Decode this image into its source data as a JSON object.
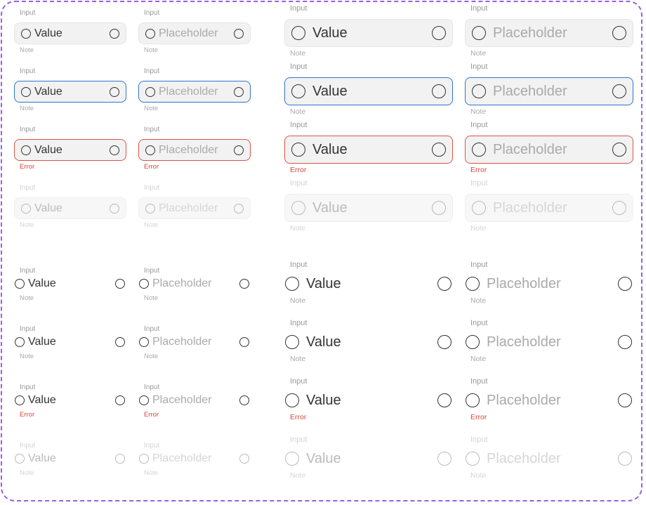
{
  "colors": {
    "focus": "#2f74d0",
    "error": "#d9453b",
    "frame": "#9b5de5"
  },
  "icons": {
    "leading": "circle-icon",
    "trailing": "circle-icon"
  },
  "fields": [
    {
      "variant": "filled",
      "size": "small",
      "state": "default",
      "label": "Input",
      "text": "Value",
      "placeholder": false,
      "note": "Note"
    },
    {
      "variant": "filled",
      "size": "small",
      "state": "default",
      "label": "Input",
      "text": "Placeholder",
      "placeholder": true,
      "note": "Note"
    },
    {
      "variant": "filled",
      "size": "large",
      "state": "default",
      "label": "Input",
      "text": "Value",
      "placeholder": false,
      "note": "Note"
    },
    {
      "variant": "filled",
      "size": "large",
      "state": "default",
      "label": "Input",
      "text": "Placeholder",
      "placeholder": true,
      "note": "Note"
    },
    {
      "variant": "filled",
      "size": "small",
      "state": "focus",
      "label": "Input",
      "text": "Value",
      "placeholder": false,
      "note": "Note"
    },
    {
      "variant": "filled",
      "size": "small",
      "state": "focus",
      "label": "Input",
      "text": "Placeholder",
      "placeholder": true,
      "note": "Note"
    },
    {
      "variant": "filled",
      "size": "large",
      "state": "focus",
      "label": "Input",
      "text": "Value",
      "placeholder": false,
      "note": "Note"
    },
    {
      "variant": "filled",
      "size": "large",
      "state": "focus",
      "label": "Input",
      "text": "Placeholder",
      "placeholder": true,
      "note": "Note"
    },
    {
      "variant": "filled",
      "size": "small",
      "state": "error",
      "label": "Input",
      "text": "Value",
      "placeholder": false,
      "note": "Error"
    },
    {
      "variant": "filled",
      "size": "small",
      "state": "error",
      "label": "Input",
      "text": "Placeholder",
      "placeholder": true,
      "note": "Error"
    },
    {
      "variant": "filled",
      "size": "large",
      "state": "error",
      "label": "Input",
      "text": "Value",
      "placeholder": false,
      "note": "Error"
    },
    {
      "variant": "filled",
      "size": "large",
      "state": "error",
      "label": "Input",
      "text": "Placeholder",
      "placeholder": true,
      "note": "Error"
    },
    {
      "variant": "filled",
      "size": "small",
      "state": "disabled",
      "label": "Input",
      "text": "Value",
      "placeholder": false,
      "note": "Note"
    },
    {
      "variant": "filled",
      "size": "small",
      "state": "disabled",
      "label": "Input",
      "text": "Placeholder",
      "placeholder": true,
      "note": "Note"
    },
    {
      "variant": "filled",
      "size": "large",
      "state": "disabled",
      "label": "Input",
      "text": "Value",
      "placeholder": false,
      "note": "Note"
    },
    {
      "variant": "filled",
      "size": "large",
      "state": "disabled",
      "label": "Input",
      "text": "Placeholder",
      "placeholder": true,
      "note": "Note"
    },
    {
      "variant": "underline",
      "size": "small",
      "state": "default",
      "label": "Input",
      "text": "Value",
      "placeholder": false,
      "note": "Note"
    },
    {
      "variant": "underline",
      "size": "small",
      "state": "default",
      "label": "Input",
      "text": "Placeholder",
      "placeholder": true,
      "note": "Note"
    },
    {
      "variant": "underline",
      "size": "large",
      "state": "default",
      "label": "Input",
      "text": "Value",
      "placeholder": false,
      "note": "Note"
    },
    {
      "variant": "underline",
      "size": "large",
      "state": "default",
      "label": "Input",
      "text": "Placeholder",
      "placeholder": true,
      "note": "Note"
    },
    {
      "variant": "underline",
      "size": "small",
      "state": "focus",
      "label": "Input",
      "text": "Value",
      "placeholder": false,
      "note": "Note"
    },
    {
      "variant": "underline",
      "size": "small",
      "state": "focus",
      "label": "Input",
      "text": "Placeholder",
      "placeholder": true,
      "note": "Note"
    },
    {
      "variant": "underline",
      "size": "large",
      "state": "focus",
      "label": "Input",
      "text": "Value",
      "placeholder": false,
      "note": "Note"
    },
    {
      "variant": "underline",
      "size": "large",
      "state": "focus",
      "label": "Input",
      "text": "Placeholder",
      "placeholder": true,
      "note": "Note"
    },
    {
      "variant": "underline",
      "size": "small",
      "state": "error",
      "label": "Input",
      "text": "Value",
      "placeholder": false,
      "note": "Error"
    },
    {
      "variant": "underline",
      "size": "small",
      "state": "error",
      "label": "Input",
      "text": "Placeholder",
      "placeholder": true,
      "note": "Error"
    },
    {
      "variant": "underline",
      "size": "large",
      "state": "error",
      "label": "Input",
      "text": "Value",
      "placeholder": false,
      "note": "Error"
    },
    {
      "variant": "underline",
      "size": "large",
      "state": "error",
      "label": "Input",
      "text": "Placeholder",
      "placeholder": true,
      "note": "Error"
    },
    {
      "variant": "underline",
      "size": "small",
      "state": "disabled",
      "label": "Input",
      "text": "Value",
      "placeholder": false,
      "note": "Note"
    },
    {
      "variant": "underline",
      "size": "small",
      "state": "disabled",
      "label": "Input",
      "text": "Placeholder",
      "placeholder": true,
      "note": "Note"
    },
    {
      "variant": "underline",
      "size": "large",
      "state": "disabled",
      "label": "Input",
      "text": "Value",
      "placeholder": false,
      "note": "Note"
    },
    {
      "variant": "underline",
      "size": "large",
      "state": "disabled",
      "label": "Input",
      "text": "Placeholder",
      "placeholder": true,
      "note": "Note"
    }
  ]
}
